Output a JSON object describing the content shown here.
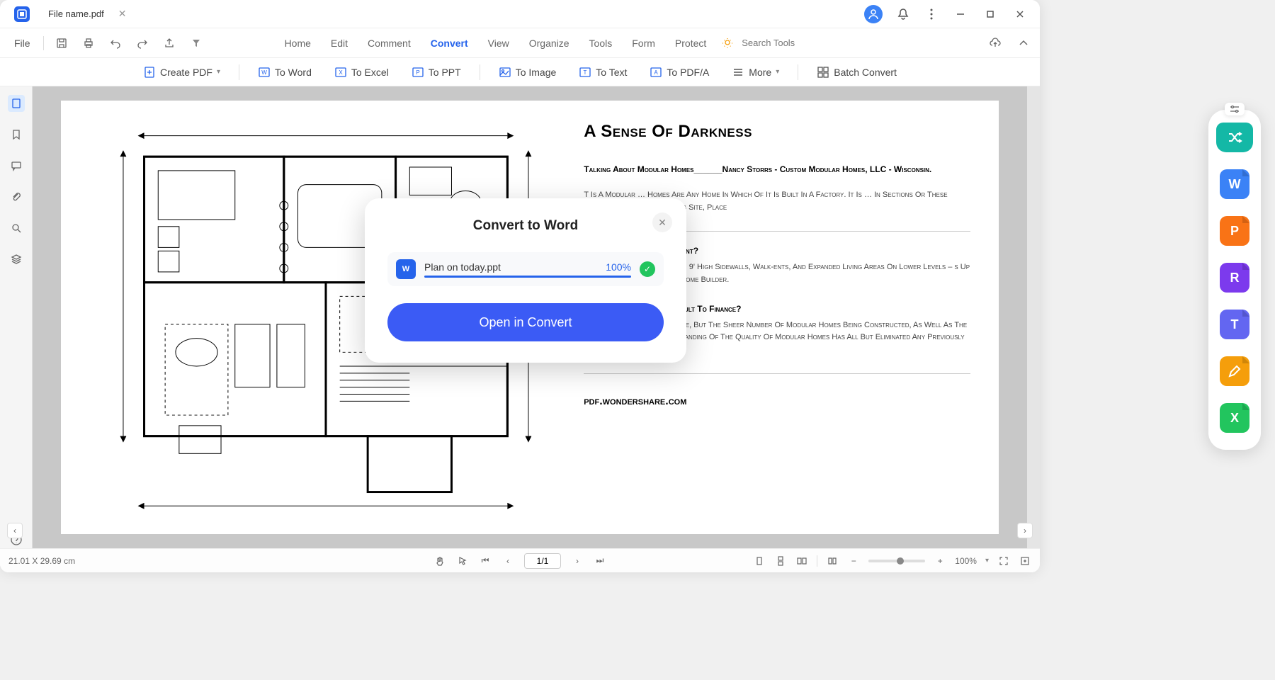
{
  "titlebar": {
    "tab_name": "File name.pdf"
  },
  "menubar": {
    "file": "File",
    "tabs": [
      "Home",
      "Edit",
      "Comment",
      "Convert",
      "View",
      "Organize",
      "Tools",
      "Form",
      "Protect"
    ],
    "active_tab_index": 3,
    "search_placeholder": "Search Tools"
  },
  "toolbar": {
    "create_pdf": "Create PDF",
    "to_word": "To Word",
    "to_excel": "To Excel",
    "to_ppt": "To PPT",
    "to_image": "To Image",
    "to_text": "To Text",
    "to_pdfa": "To PDF/A",
    "more": "More",
    "batch_convert": "Batch Convert"
  },
  "document": {
    "title": "A Sense Of Darkness",
    "subtitle": "Talking About Modular Homes______Nancy Storrs - Custom Modular Homes, LLC - Wisconsin.",
    "body1": "T Is A Modular … Homes Are Any Home In Which Of It Is Built In A Factory. It Is … In Sections Or These Modules Are … To A Building Site, Place",
    "q1": "odular Home Have A Basement?",
    "a1": "ost Of Them Do – Often With 9' High Sidewalls, Walk-ents, And Expanded Living Areas On Lower Levels – s Up To You, And Your Modular Home Builder.",
    "q2": "· Are Modular Homes Difficult To Finance?",
    "a2": "No. That Used To Be The Case, But The Sheer Number Of Modular Homes Being Constructed, As Well As The Lending Community's Understanding Of The Quality Of Modular Homes Has All But Eliminated Any Previously Existing Prejudice.",
    "footer": "pdf.wondershare.com"
  },
  "modal": {
    "title": "Convert to Word",
    "file_name": "Plan on today.ppt",
    "progress_pct": "100%",
    "button": "Open in Convert"
  },
  "statusbar": {
    "dimensions": "21.01 X 29.69 cm",
    "page": "1/1",
    "zoom": "100%"
  },
  "dock": {
    "labels": {
      "word": "W",
      "ppt": "P",
      "r": "R",
      "t": "T",
      "excel": "X"
    }
  }
}
